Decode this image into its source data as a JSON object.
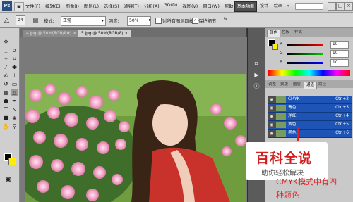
{
  "app": {
    "logo": "Ps"
  },
  "menubar": {
    "items": [
      "文件(F)",
      "编辑(E)",
      "图像(I)",
      "图层(L)",
      "选择(S)",
      "滤镜(T)",
      "分析(A)",
      "3D(D)",
      "视图(V)",
      "窗口(W)",
      "帮助(H)"
    ],
    "zoom": "50%",
    "workspaces": {
      "active": "基本功能",
      "design": "设计",
      "painting": "绘画"
    },
    "more": "»"
  },
  "optbar": {
    "mode_label": "模式:",
    "mode_value": "正常",
    "strength_label": "强度:",
    "strength_value": "50%",
    "sample_all": "对所有图层取样",
    "protect_detail": "保护细节",
    "brush_size": "24"
  },
  "tabs": [
    {
      "label": "4.jpg @ 50%(RGB/8#)",
      "active": false
    },
    {
      "label": "5.jpg @ 50%(RGB/8)",
      "active": true
    }
  ],
  "color_panel": {
    "tabs": [
      "颜色",
      "色板",
      "样式"
    ],
    "channels": [
      {
        "name": "R",
        "value": "10"
      },
      {
        "name": "G",
        "value": "10"
      },
      {
        "name": "B",
        "value": "10"
      }
    ]
  },
  "layers_panel": {
    "tabs": [
      "调整",
      "蒙版",
      "图层",
      "通道",
      "路径"
    ],
    "channels": [
      {
        "name": "CMYK",
        "shortcut": "Ctrl+2"
      },
      {
        "name": "青色",
        "shortcut": "Ctrl+3"
      },
      {
        "name": "洋红",
        "shortcut": "Ctrl+4"
      },
      {
        "name": "黄色",
        "shortcut": "Ctrl+5"
      },
      {
        "name": "黑色",
        "shortcut": "Ctrl+6"
      }
    ]
  },
  "watermark": {
    "title": "百科全说",
    "subtitle": "助你轻松解决"
  },
  "caption": {
    "line1": "CMYK模式中有四",
    "line2": "种颜色"
  },
  "colors": {
    "accent_blue": "#1e54b5",
    "caption_red": "#e02020",
    "watermark_red": "#d11f1f"
  }
}
